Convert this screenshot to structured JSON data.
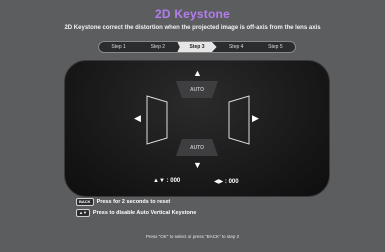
{
  "title": "2D Keystone",
  "subtitle": "2D Keystone correct the distortion when the projected image is off-axis from the lens axis",
  "steps": [
    "Step 1",
    "Step 2",
    "Step 3",
    "Step 4",
    "Step 5"
  ],
  "active_step": "Step 3",
  "controls": {
    "auto_top": "AUTO",
    "auto_bottom": "AUTO",
    "vertical_value": ": 000",
    "horizontal_value": ": 000"
  },
  "hints": {
    "back_key": "BACK",
    "back_text": "Press for 2 seconds to reset",
    "updown_key": "▲▼",
    "updown_text": "Press to disable Auto Vertical Keystone"
  },
  "footer": "Press \"OK\" to select or press \"BACK\" to step 2"
}
